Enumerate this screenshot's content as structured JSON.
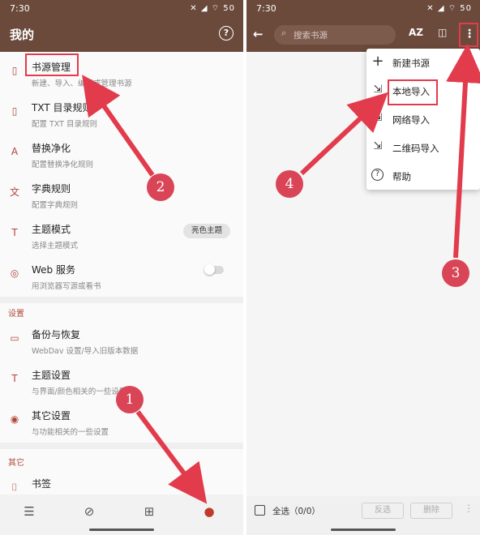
{
  "left": {
    "statusbar": {
      "time": "7:30",
      "icons": "✕ ◢ ⌔ 50"
    },
    "title": "我的",
    "help_icon": "?",
    "items": [
      {
        "title": "书源管理",
        "desc": "新建、导入、编辑或管理书源",
        "icon": "book-icon"
      },
      {
        "title": "TXT 目录规则",
        "desc": "配置 TXT 目录规则",
        "icon": "book-icon"
      },
      {
        "title": "替换净化",
        "desc": "配置替换净化规则",
        "icon": "replace-icon"
      },
      {
        "title": "字典规则",
        "desc": "配置字典规则",
        "icon": "translate-icon"
      },
      {
        "title": "主题模式",
        "desc": "选择主题模式",
        "icon": "shirt-icon",
        "chip": "亮色主题"
      },
      {
        "title": "Web 服务",
        "desc": "用浏览器写源或看书",
        "icon": "globe-icon"
      }
    ],
    "section_settings": "设置",
    "settings_items": [
      {
        "title": "备份与恢复",
        "desc": "WebDav 设置/导入旧版本数据",
        "icon": "folder-icon"
      },
      {
        "title": "主题设置",
        "desc": "与界面/颜色相关的一些设置",
        "icon": "shirt-icon"
      },
      {
        "title": "其它设置",
        "desc": "与功能相关的一些设置",
        "icon": "settings-icon"
      }
    ],
    "section_other": "其它",
    "other_items": [
      {
        "title": "书签",
        "icon": "bookmark-icon"
      }
    ]
  },
  "right": {
    "statusbar": {
      "time": "7:30",
      "icons": "✕ ◢ ⌔ 50"
    },
    "search_placeholder": "搜索书源",
    "menu": [
      {
        "label": "新建书源",
        "icon": "+"
      },
      {
        "label": "本地导入",
        "icon": "⇲"
      },
      {
        "label": "网络导入",
        "icon": "⇲"
      },
      {
        "label": "二维码导入",
        "icon": "⇲"
      },
      {
        "label": "帮助",
        "icon": "?"
      }
    ],
    "footer": {
      "select_all": "全选（0/0）",
      "invert": "反选",
      "delete": "删除"
    }
  },
  "annotations": {
    "badges": [
      "1",
      "2",
      "3",
      "4"
    ],
    "color": "#e23b4c"
  }
}
